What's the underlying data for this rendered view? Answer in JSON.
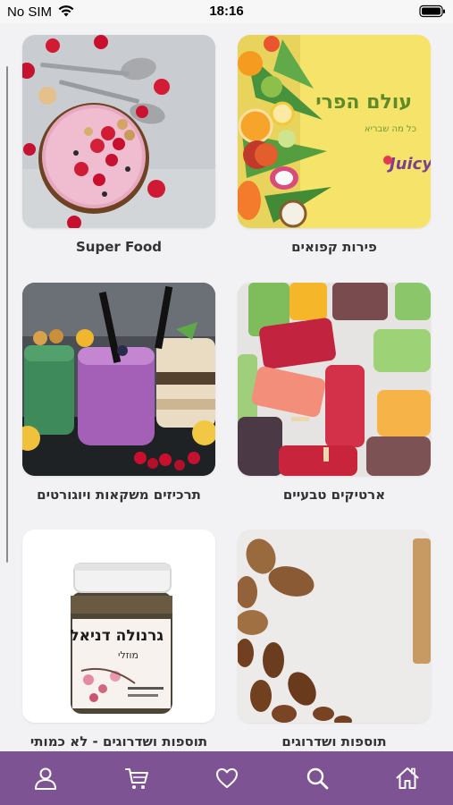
{
  "status_bar": {
    "carrier": "No SIM",
    "time": "18:16"
  },
  "categories": [
    {
      "label": "פירות קפואים",
      "logo_text": "עולם הפרי",
      "logo_tagline": "כל מה שבריא",
      "logo_brand": "Juicy"
    },
    {
      "label": "Super Food"
    },
    {
      "label": "ארטיקים טבעיים"
    },
    {
      "label": "תרכיזים משקאות ויוגורטים"
    },
    {
      "label": "תוספות ושדרוגים"
    },
    {
      "label": "תוספות ושדרוגים - לא כמותי",
      "jar_title": "גרנולה דניאל",
      "jar_subtitle": "מוזלי"
    }
  ],
  "tab_bar": {
    "background": "#7e5393",
    "icons": [
      "home-icon",
      "search-icon",
      "heart-icon",
      "cart-icon",
      "profile-icon"
    ]
  }
}
